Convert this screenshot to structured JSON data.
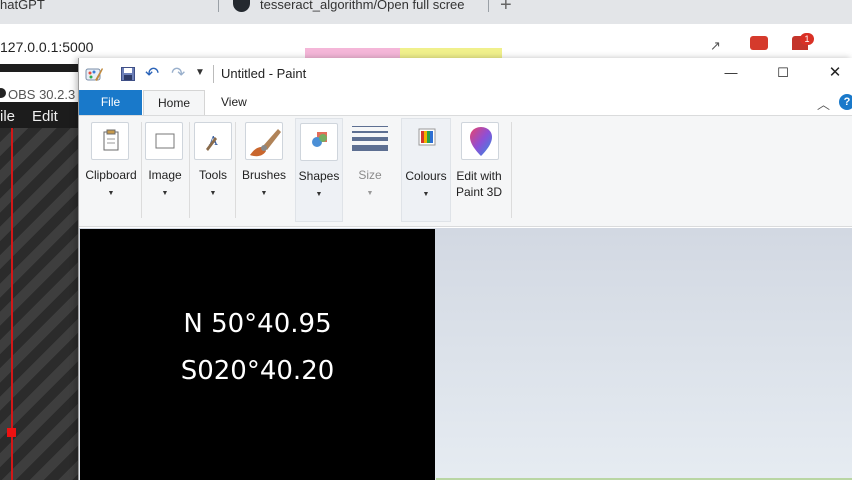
{
  "browser": {
    "tabs": [
      {
        "title": "hatGPT"
      },
      {
        "title": "tesseract_algorithm/Open full scree"
      }
    ],
    "address": "127.0.0.1:5000",
    "badge_count": "1"
  },
  "obs": {
    "title": "OBS 30.2.3",
    "menus": {
      "file": "ile",
      "edit": "Edit"
    }
  },
  "paint": {
    "window_title": "Untitled - Paint",
    "tabs": {
      "file": "File",
      "home": "Home",
      "view": "View"
    },
    "groups": {
      "clipboard": "Clipboard",
      "image": "Image",
      "tools": "Tools",
      "brushes": "Brushes",
      "shapes": "Shapes",
      "size": "Size",
      "colours": "Colours",
      "paint3d_line1": "Edit with",
      "paint3d_line2": "Paint 3D"
    },
    "help": "?",
    "canvas": {
      "line1": "N 50°40.95",
      "line2": "S020°40.20"
    }
  },
  "colors": {
    "accent": "#1979ca",
    "canvas_bg": "#000000",
    "obs_red": "#d31717"
  }
}
